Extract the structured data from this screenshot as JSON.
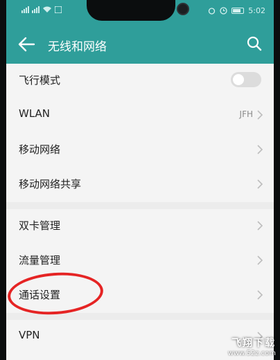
{
  "status_bar": {
    "time": "5:02",
    "signal_icons": [
      "signal-icon",
      "signal-icon"
    ],
    "right_icons": [
      "alarm-icon",
      "clock-icon"
    ]
  },
  "header": {
    "title": "无线和网络",
    "accent_color": "#2f9e9a",
    "back_icon": "arrow-left-icon",
    "search_icon": "search-icon"
  },
  "list": {
    "items": [
      {
        "label": "飞行模式",
        "type": "toggle",
        "toggle_on": false
      },
      {
        "label": "WLAN",
        "type": "link",
        "value": "JFH"
      },
      {
        "label": "移动网络",
        "type": "link",
        "value": ""
      },
      {
        "label": "移动网络共享",
        "type": "link",
        "value": ""
      },
      {
        "label": "双卡管理",
        "type": "link",
        "value": ""
      },
      {
        "label": "流量管理",
        "type": "link",
        "value": ""
      },
      {
        "label": "通话设置",
        "type": "link",
        "value": "",
        "highlighted": true
      },
      {
        "label": "VPN",
        "type": "link",
        "value": ""
      }
    ]
  },
  "annotation": {
    "highlight_color": "#e52424"
  },
  "watermark": {
    "title": "飞翔下载",
    "url": "www.52z.com"
  }
}
